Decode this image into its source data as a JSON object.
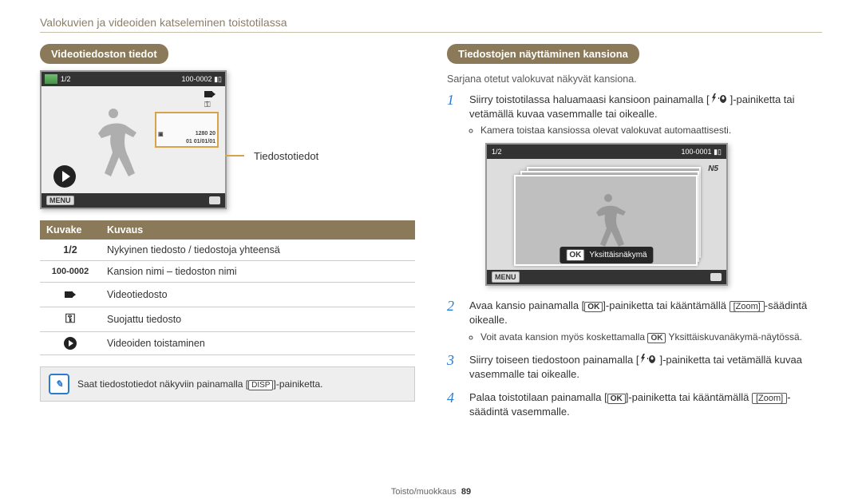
{
  "chapter_title": "Valokuvien ja videoiden katseleminen toistotilassa",
  "left": {
    "section_title": "Videotiedoston tiedot",
    "preview": {
      "top_counter": "1/2",
      "top_file": "100-0002",
      "info_res": "1280   20",
      "info_date": "01   01/01/01",
      "menu_label": "MENU"
    },
    "callout_label": "Tiedostotiedot",
    "table": {
      "head_icon": "Kuvake",
      "head_desc": "Kuvaus",
      "rows": [
        {
          "icon_type": "text",
          "icon": "1/2",
          "desc": "Nykyinen tiedosto / tiedostoja yhteensä"
        },
        {
          "icon_type": "text",
          "icon": "100-0002",
          "desc": "Kansion nimi – tiedoston nimi"
        },
        {
          "icon_type": "camcorder",
          "icon": "",
          "desc": "Videotiedosto"
        },
        {
          "icon_type": "key",
          "icon": "",
          "desc": "Suojattu tiedosto"
        },
        {
          "icon_type": "play",
          "icon": "",
          "desc": "Videoiden toistaminen"
        }
      ]
    },
    "tip": {
      "text_before": "Saat tiedostotiedot näkyviin painamalla [",
      "chip": "DISP",
      "text_after": "]-painiketta."
    }
  },
  "right": {
    "section_title": "Tiedostojen näyttäminen kansiona",
    "intro": "Sarjana otetut valokuvat näkyvät kansiona.",
    "steps": [
      {
        "n": "1",
        "text_a": "Siirry toistotilassa haluamaasi kansioon painamalla [",
        "text_b": "]-painiketta tai vetämällä kuvaa vasemmalle tai oikealle.",
        "bullet": "Kamera toistaa kansiossa olevat valokuvat automaattisesti."
      },
      {
        "n": "2",
        "text_a": "Avaa kansio painamalla [",
        "mid": "]-painiketta tai kääntämällä ",
        "zoom": "[Zoom]",
        "text_b": "-säädintä oikealle.",
        "bullet_a": "Voit avata kansion myös koskettamalla ",
        "bullet_kbd": "OK",
        "bullet_b": " Yksittäiskuvanäkymä-näytössä."
      },
      {
        "n": "3",
        "text_a": "Siirry toiseen tiedostoon painamalla [",
        "text_b": "]-painiketta tai vetämällä kuvaa vasemmalle tai oikealle."
      },
      {
        "n": "4",
        "text_a": "Palaa toistotilaan painamalla [",
        "mid": "]-painiketta tai kääntämällä ",
        "zoom": "[Zoom]",
        "text_b": "-säädintä vasemmalle."
      }
    ],
    "folder": {
      "top_counter": "1/2",
      "top_file": "100-0001",
      "menu_label": "MENU",
      "badge": "N5",
      "ok_kbd": "OK",
      "ok_label": "Yksittäisnäkymä"
    }
  },
  "footer": {
    "section": "Toisto/muokkaus",
    "page": "89"
  },
  "labels": {
    "ok": "OK"
  }
}
